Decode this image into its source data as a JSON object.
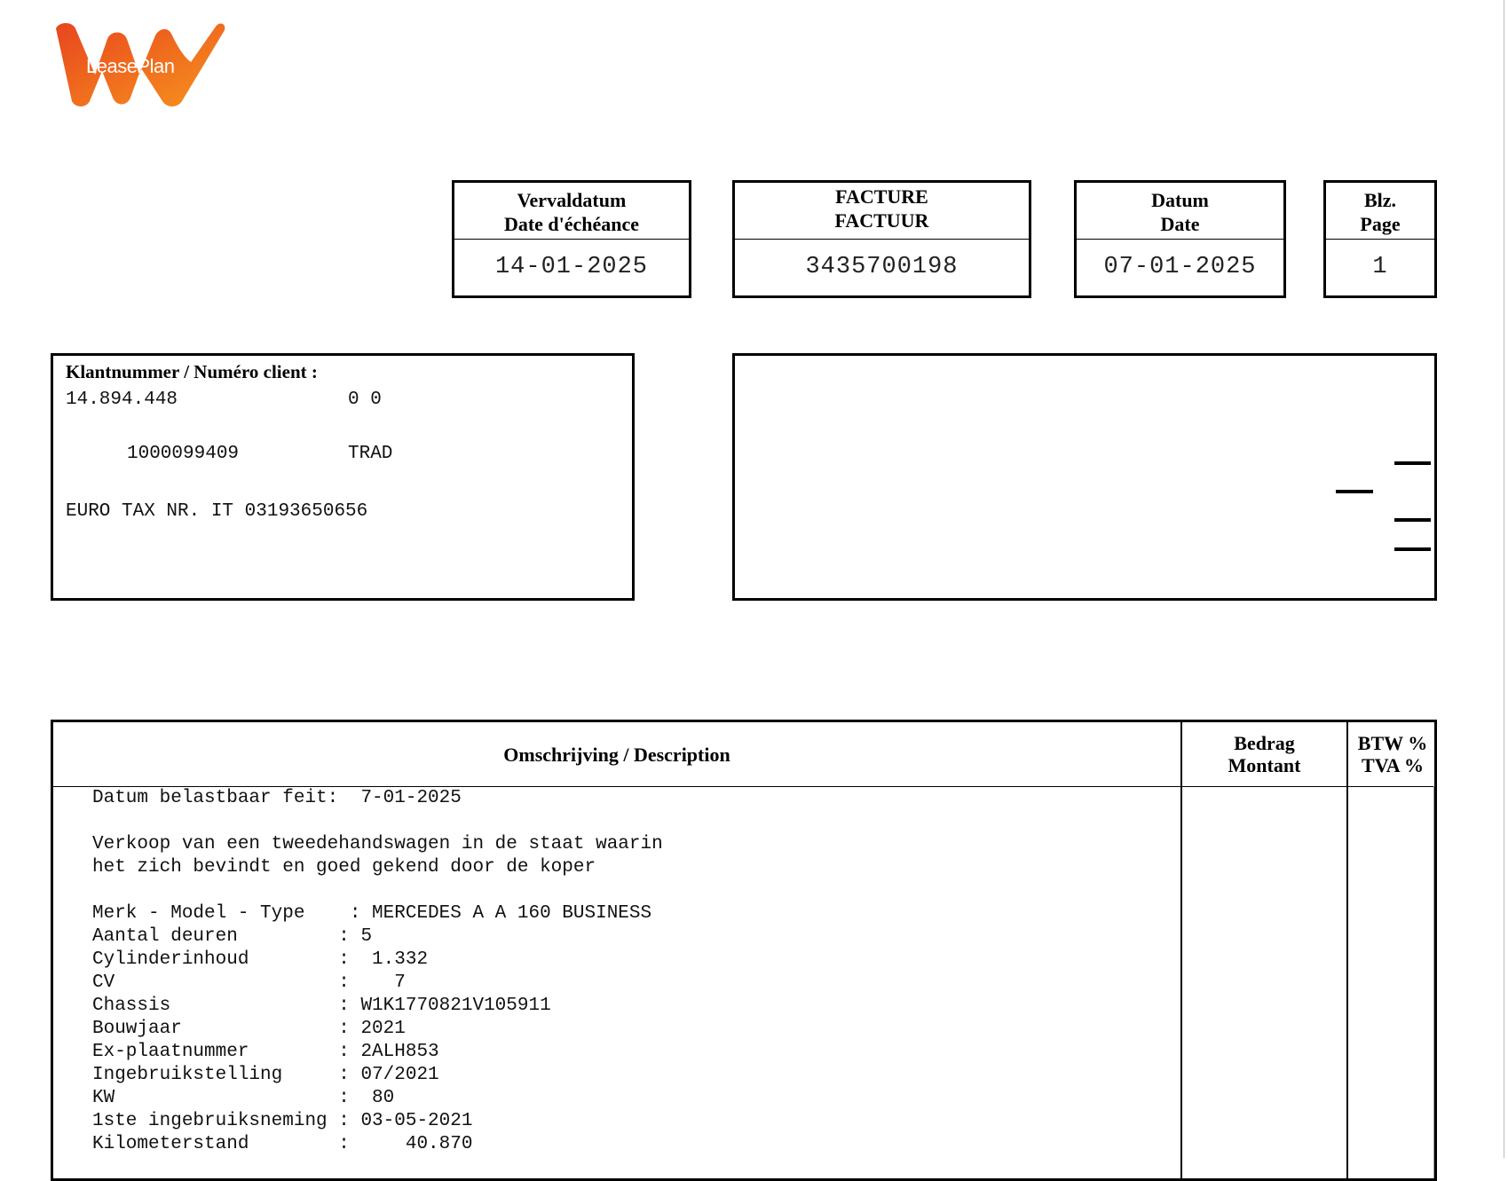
{
  "logo": {
    "text": "LeasePlan",
    "colors": [
      "#f15a22",
      "#f7941d"
    ]
  },
  "header_boxes": {
    "due_date": {
      "label_nl": "Vervaldatum",
      "label_fr": "Date d'échéance",
      "value": "14-01-2025"
    },
    "invoice": {
      "label_fr": "FACTURE",
      "label_nl": "FACTUUR",
      "value": "3435700198"
    },
    "date": {
      "label_nl": "Datum",
      "label_fr": "Date",
      "value": "07-01-2025"
    },
    "page": {
      "label_nl": "Blz.",
      "label_fr": "Page",
      "value": "1"
    }
  },
  "client": {
    "title": "Klantnummer / Numéro client :",
    "number": "14.894.448",
    "code": "0 0",
    "ref": "1000099409",
    "type": "TRAD",
    "tax": "EURO TAX NR. IT 03193650656"
  },
  "table": {
    "headers": {
      "description": "Omschrijving / Description",
      "amount_nl": "Bedrag",
      "amount_fr": "Montant",
      "vat_nl": "BTW %",
      "vat_fr": "TVA %"
    },
    "lines": [
      "Datum belastbaar feit:  7-01-2025",
      "",
      "Verkoop van een tweedehandswagen in de staat waarin",
      "het zich bevindt en goed gekend door de koper",
      "",
      "Merk - Model - Type    : MERCEDES A A 160 BUSINESS",
      "Aantal deuren         : 5",
      "Cylinderinhoud        :  1.332",
      "CV                    :    7",
      "Chassis               : W1K1770821V105911",
      "Bouwjaar              : 2021",
      "Ex-plaatnummer        : 2ALH853",
      "Ingebruikstelling     : 07/2021",
      "KW                    :  80",
      "1ste ingebruiksneming : 03-05-2021",
      "Kilometerstand        :     40.870"
    ]
  }
}
